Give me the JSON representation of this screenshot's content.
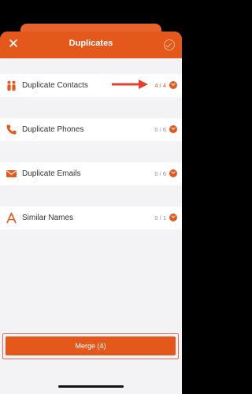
{
  "app": {
    "title": "Duplicates",
    "accent_color": "#e4581c",
    "header_icons": [
      "close-icon",
      "check-circle-icon"
    ]
  },
  "rows": [
    {
      "label": "Duplicate Contacts",
      "count": "4 / 4",
      "icon": "people-icon",
      "highlighted": true
    },
    {
      "label": "Duplicate Phones",
      "count": "0 / 6",
      "icon": "phone-icon",
      "highlighted": false
    },
    {
      "label": "Duplicate Emails",
      "count": "0 / 6",
      "icon": "envelope-icon",
      "highlighted": false
    },
    {
      "label": "Similar Names",
      "count": "0 / 1",
      "icon": "letter-a-icon",
      "highlighted": false
    }
  ],
  "merge": {
    "label": "Merge (4)"
  }
}
